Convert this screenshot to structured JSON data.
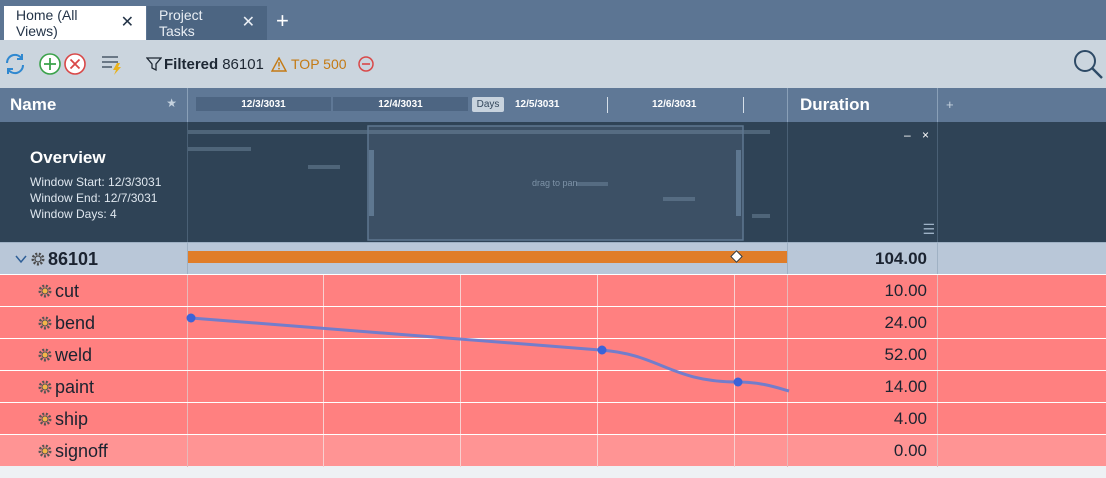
{
  "tabs": [
    {
      "label": "Home (All Views)",
      "active": true
    },
    {
      "label": "Project Tasks",
      "active": false
    }
  ],
  "toolbar": {
    "filter_label": "Filtered",
    "filter_value": "86101",
    "top_label": "TOP 500"
  },
  "columns": {
    "name": "Name",
    "duration": "Duration"
  },
  "timeline": {
    "dates": [
      "12/3/3031",
      "12/4/3031",
      "12/5/3031",
      "12/6/3031"
    ],
    "unit_label": "Days"
  },
  "overview": {
    "title": "Overview",
    "window_start": "Window Start: 12/3/3031",
    "window_end": "Window End: 12/7/3031",
    "window_days": "Window Days: 4",
    "drag_hint": "drag to pan",
    "minimize": "–",
    "close": "×"
  },
  "summary_row": {
    "name": "86101",
    "duration": "104.00",
    "bar_color": "#e07d28"
  },
  "task_rows": [
    {
      "name": "cut",
      "duration": "10.00"
    },
    {
      "name": "bend",
      "duration": "24.00"
    },
    {
      "name": "weld",
      "duration": "52.00"
    },
    {
      "name": "paint",
      "duration": "14.00"
    },
    {
      "name": "ship",
      "duration": "4.00"
    },
    {
      "name": "signoff",
      "duration": "0.00"
    }
  ],
  "colors": {
    "tab_bar": "#5c7593",
    "header": "#5f7896",
    "overview_bg": "#2f4356",
    "task_row": "#ff8080",
    "summary_row": "#b9c7d8",
    "link_line": "#6b7ccf",
    "top_warning": "#c47a14"
  },
  "icons": {
    "refresh": "refresh-icon",
    "add": "add-circle-icon",
    "remove": "remove-circle-icon",
    "bulk_edit": "bulk-edit-icon",
    "filter": "filter-icon",
    "warning": "warning-icon",
    "minus": "minus-circle-icon",
    "search": "search-icon",
    "gear": "gear-icon"
  }
}
